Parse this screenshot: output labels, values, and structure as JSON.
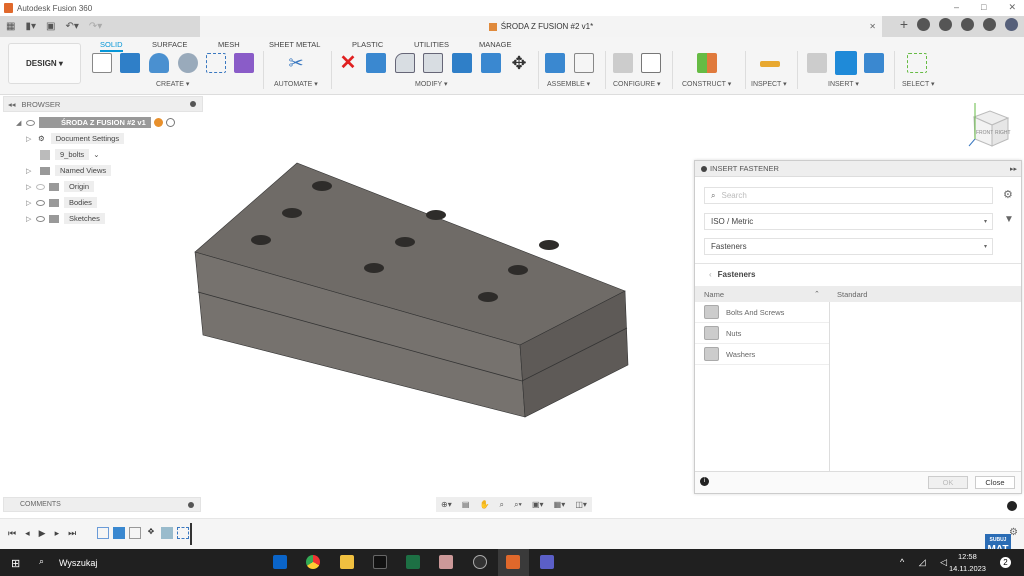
{
  "app": {
    "title": "Autodesk Fusion 360",
    "document_title": "ŚRODA Z FUSION #2 v1*"
  },
  "ribbon": {
    "workspace": "DESIGN ▾",
    "tabs": [
      "SOLID",
      "SURFACE",
      "MESH",
      "SHEET METAL",
      "PLASTIC",
      "UTILITIES",
      "MANAGE"
    ],
    "active_tab": "SOLID",
    "groups": [
      "CREATE ▾",
      "AUTOMATE ▾",
      "MODIFY ▾",
      "ASSEMBLE ▾",
      "CONFIGURE ▾",
      "CONSTRUCT ▾",
      "INSPECT ▾",
      "INSERT ▾",
      "SELECT ▾"
    ]
  },
  "browser": {
    "title": "BROWSER",
    "root": "ŚRODA Z FUSION #2 v1",
    "items": [
      "Document Settings",
      "9_bolts",
      "Named Views",
      "Origin",
      "Bodies",
      "Sketches"
    ]
  },
  "viewcube": {
    "front": "FRONT",
    "right": "RIGHT"
  },
  "insert_fastener": {
    "title": "INSERT FASTENER",
    "search_placeholder": "Search",
    "standard_select": "ISO / Metric",
    "category_select": "Fasteners",
    "breadcrumb": "Fasteners",
    "col_name": "Name",
    "col_standard": "Standard",
    "rows": [
      "Bolts And Screws",
      "Nuts",
      "Washers"
    ],
    "ok": "OK",
    "close": "Close"
  },
  "comments": {
    "title": "COMMENTS"
  },
  "taskbar": {
    "search": "Wyszukaj",
    "time": "12:58",
    "date": "14.11.2023",
    "notifications": "2",
    "badge_top": "SUBUJ",
    "badge_bottom": "MAT"
  },
  "colors": {
    "accent": "#0696d7",
    "model": "#6e6a66",
    "taskbar": "#202020"
  }
}
